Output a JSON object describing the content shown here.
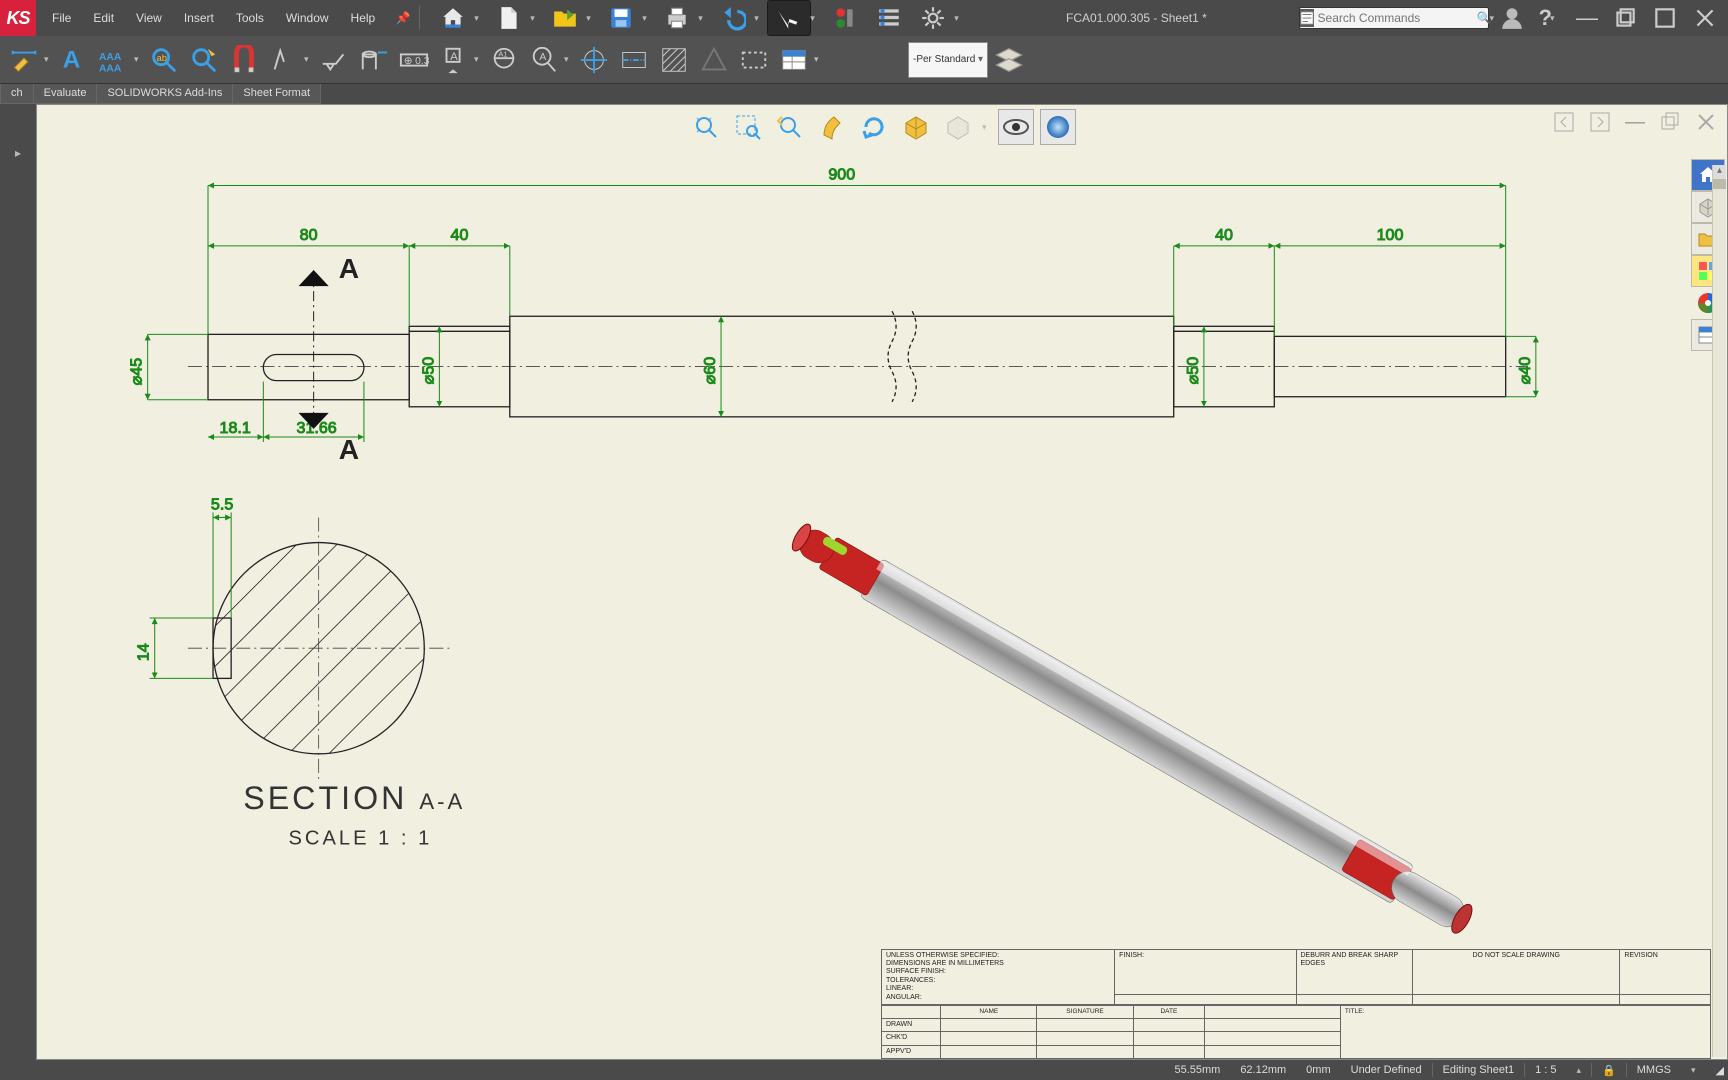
{
  "app": {
    "logo": "KS"
  },
  "menu": {
    "file": "File",
    "edit": "Edit",
    "view": "View",
    "insert": "Insert",
    "tools": "Tools",
    "window": "Window",
    "help": "Help"
  },
  "doc": {
    "title": "FCA01.000.305 - Sheet1 *"
  },
  "search": {
    "placeholder": "Search Commands"
  },
  "linestyle": {
    "label": "-Per Standard"
  },
  "tabs": {
    "sketch": "ch",
    "evaluate": "Evaluate",
    "addins": "SOLIDWORKS Add-Ins",
    "sheetformat": "Sheet Format"
  },
  "dims": {
    "overall": "900",
    "d1": "80",
    "d2": "40",
    "d3": "40",
    "d4": "100",
    "dia45": "⌀45",
    "dia50a": "⌀50",
    "dia60": "⌀60",
    "dia50b": "⌀50",
    "dia40": "⌀40",
    "s1": "18.1",
    "s2": "31.66",
    "ssw": "5.5",
    "ssh": "14",
    "amark": "A"
  },
  "section": {
    "title": "SECTION",
    "sub": "A-A",
    "scale": "SCALE 1 : 1"
  },
  "titleblock": {
    "spec": "UNLESS OTHERWISE SPECIFIED:",
    "dimmm": "DIMENSIONS ARE IN MILLIMETERS",
    "surf": "SURFACE FINISH:",
    "tol": "TOLERANCES:",
    "lin": "  LINEAR:",
    "ang": "  ANGULAR:",
    "finish": "FINISH:",
    "deburr": "DEBURR AND BREAK SHARP EDGES",
    "dns": "DO NOT SCALE DRAWING",
    "rev": "REVISION",
    "name": "NAME",
    "sig": "SIGNATURE",
    "date": "DATE",
    "drawn": "DRAWN",
    "chkd": "CHK'D",
    "appvd": "APPV'D",
    "title": "TITLE:"
  },
  "status": {
    "x": "55.55mm",
    "y": "62.12mm",
    "z": "0mm",
    "def": "Under Defined",
    "mode": "Editing Sheet1",
    "scale": "1 : 5",
    "units": "MMGS"
  }
}
